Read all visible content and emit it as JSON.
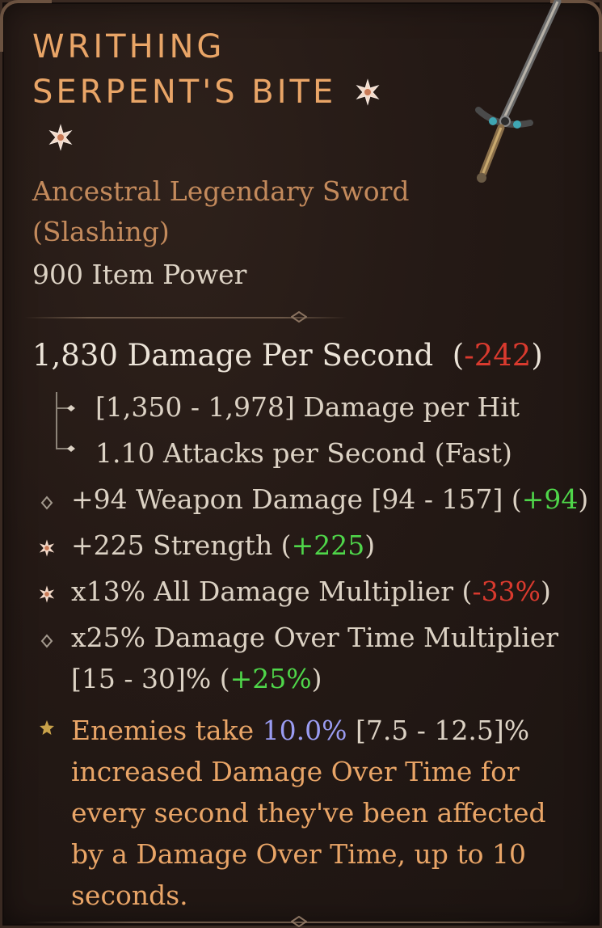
{
  "item": {
    "name_line1": "WRITHING",
    "name_line2": "SERPENT'S BITE",
    "type_line1": "Ancestral Legendary Sword",
    "type_line2": "(Slashing)",
    "item_power": "900 Item Power"
  },
  "dps": {
    "value_text": "1,830 Damage Per Second",
    "open_paren": "(",
    "delta": "-242",
    "close_paren": ")"
  },
  "weapon_details": {
    "damage_per_hit": "[1,350 - 1,978] Damage per Hit",
    "attacks_per_second": "1.10 Attacks per Second (Fast)"
  },
  "affixes": [
    {
      "icon": "diamond-bullet",
      "text": "+94 Weapon Damage [94 - 157] (",
      "delta": "+94",
      "close": ")",
      "delta_kind": "pos"
    },
    {
      "icon": "greater-affix-flower",
      "text": "+225 Strength (",
      "delta": "+225",
      "close": ")",
      "delta_kind": "pos"
    },
    {
      "icon": "greater-affix-flower",
      "text": "x13% All Damage Multiplier (",
      "delta": "-33%",
      "close": ")",
      "delta_kind": "neg"
    },
    {
      "icon": "diamond-bullet",
      "text_line1": "x25% Damage Over Time Multiplier",
      "text_line2": "[15 - 30]% (",
      "delta": "+25%",
      "close": ")",
      "delta_kind": "pos"
    }
  ],
  "legendary_power": {
    "icon": "star-bullet",
    "part1": "Enemies take ",
    "value": "10.0%",
    "range": " [7.5 - 12.5]%",
    "part2": "increased Damage Over Time for every second they've been affected by a Damage Over Time, up to 10 seconds."
  },
  "colors": {
    "title": "#e9a567",
    "type": "#c38a5c",
    "text": "#dcd2c4",
    "negative": "#d93a2e",
    "positive": "#4fd64a",
    "value_blue": "#9a9cf2"
  }
}
